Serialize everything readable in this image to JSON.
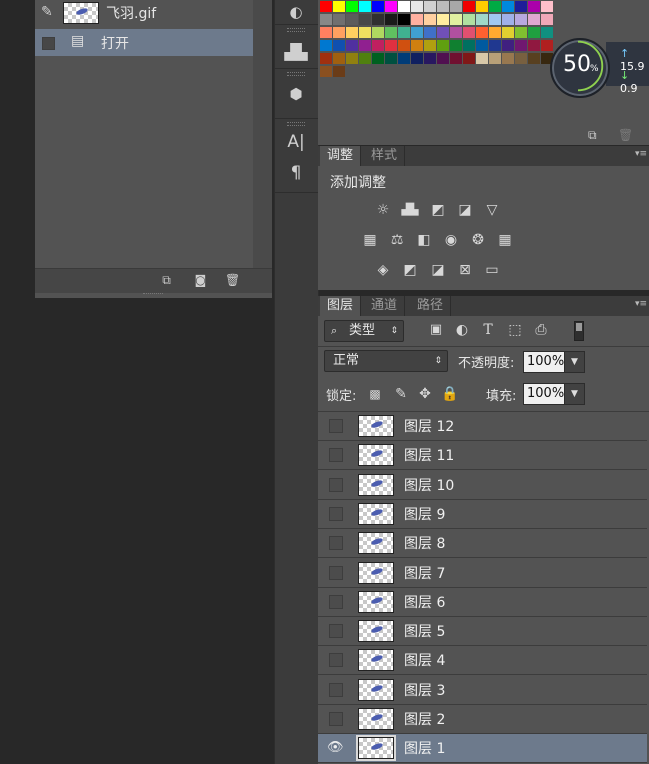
{
  "history": {
    "items": [
      {
        "label": "飞羽.gif",
        "selected": false
      },
      {
        "label": "打开",
        "selected": true
      }
    ],
    "footer_icons": [
      "new-document-from-state-icon",
      "snapshot-camera-icon",
      "trash-icon"
    ]
  },
  "swatches": {
    "rows": [
      [
        "#ff0000",
        "#ffff00",
        "#00ff00",
        "#00ffff",
        "#0000ff",
        "#ff00ff",
        "#ffffff",
        "#e6e6e6",
        "#d0d0d0",
        "#bcbcbc",
        "#a8a8a8",
        "#f00000",
        "#ffcc00",
        "#00aa44",
        "#0088dd",
        "#1d1d99",
        "#aa00aa",
        "#ffc0cb"
      ],
      [
        "#888888",
        "#707070",
        "#5c5c5c",
        "#484848",
        "#303030",
        "#1a1a1a",
        "#000000",
        "#ffb0a0",
        "#ffd0a0",
        "#ffeea0",
        "#e0f0a0",
        "#b0e0a0",
        "#a0d8c8",
        "#a0c8f0",
        "#a0b0e8",
        "#b8a8e0",
        "#e0a8d0",
        "#f0a8b8"
      ],
      [
        "#ff8060",
        "#ffa060",
        "#ffd060",
        "#f0e060",
        "#b0d860",
        "#60c060",
        "#40b090",
        "#40a0d0",
        "#4070c8",
        "#7050b8",
        "#b050a0",
        "#e05070",
        "#ff6030",
        "#ffaa30",
        "#e0d030",
        "#80c030",
        "#20a040",
        "#109080"
      ],
      [
        "#0078d0",
        "#1050b0",
        "#5030a0",
        "#902090",
        "#c02060",
        "#e03040",
        "#d05010",
        "#d08010",
        "#b0a010",
        "#60a010",
        "#108030",
        "#007060",
        "#005aa0",
        "#203890",
        "#402080",
        "#701870",
        "#901840",
        "#b02020"
      ],
      [
        "#a03010",
        "#a06010",
        "#908010",
        "#508010",
        "#006020",
        "#005040",
        "#003c78",
        "#102060",
        "#281860",
        "#501050",
        "#701030",
        "#801818",
        "#d8c8a8",
        "#b8a078",
        "#987850",
        "#786040",
        "#584020",
        "#382810"
      ],
      [
        "#8a5020",
        "#6a3c18"
      ]
    ]
  },
  "zoom": {
    "value": "50",
    "unit": "%",
    "upload": "15.9",
    "download": "0.9"
  },
  "adjustments_panel": {
    "tabs": [
      {
        "label": "调整",
        "active": true
      },
      {
        "label": "样式",
        "active": false
      }
    ],
    "title": "添加调整",
    "rows": [
      [
        "brightness-contrast-icon",
        "levels-icon",
        "curves-icon",
        "exposure-icon",
        "vibrance-icon"
      ],
      [
        "hue-saturation-icon",
        "color-balance-icon",
        "black-white-icon",
        "photo-filter-icon",
        "channel-mixer-icon",
        "color-lookup-icon"
      ],
      [
        "invert-icon",
        "posterize-icon",
        "threshold-icon",
        "selective-color-icon",
        "gradient-map-icon"
      ]
    ]
  },
  "layers_panel": {
    "tabs": [
      {
        "label": "图层",
        "active": true
      },
      {
        "label": "通道",
        "active": false
      },
      {
        "label": "路径",
        "active": false
      }
    ],
    "filter_label": "类型",
    "blend_mode": "正常",
    "opacity_label": "不透明度:",
    "opacity_value": "100%",
    "lock_label": "锁定:",
    "fill_label": "填充:",
    "fill_value": "100%",
    "layers": [
      {
        "name": "图层 12",
        "visible": false,
        "selected": false
      },
      {
        "name": "图层 11",
        "visible": false,
        "selected": false
      },
      {
        "name": "图层 10",
        "visible": false,
        "selected": false
      },
      {
        "name": "图层 9",
        "visible": false,
        "selected": false
      },
      {
        "name": "图层 8",
        "visible": false,
        "selected": false
      },
      {
        "name": "图层 7",
        "visible": false,
        "selected": false
      },
      {
        "name": "图层 6",
        "visible": false,
        "selected": false
      },
      {
        "name": "图层 5",
        "visible": false,
        "selected": false
      },
      {
        "name": "图层 4",
        "visible": false,
        "selected": false
      },
      {
        "name": "图层 3",
        "visible": false,
        "selected": false
      },
      {
        "name": "图层 2",
        "visible": false,
        "selected": false
      },
      {
        "name": "图层 1",
        "visible": true,
        "selected": true
      }
    ]
  },
  "toolstrip": {
    "icons": [
      "history-brush-icon",
      "histogram-icon",
      "3d-box-icon",
      "character-icon",
      "paragraph-icon"
    ]
  }
}
